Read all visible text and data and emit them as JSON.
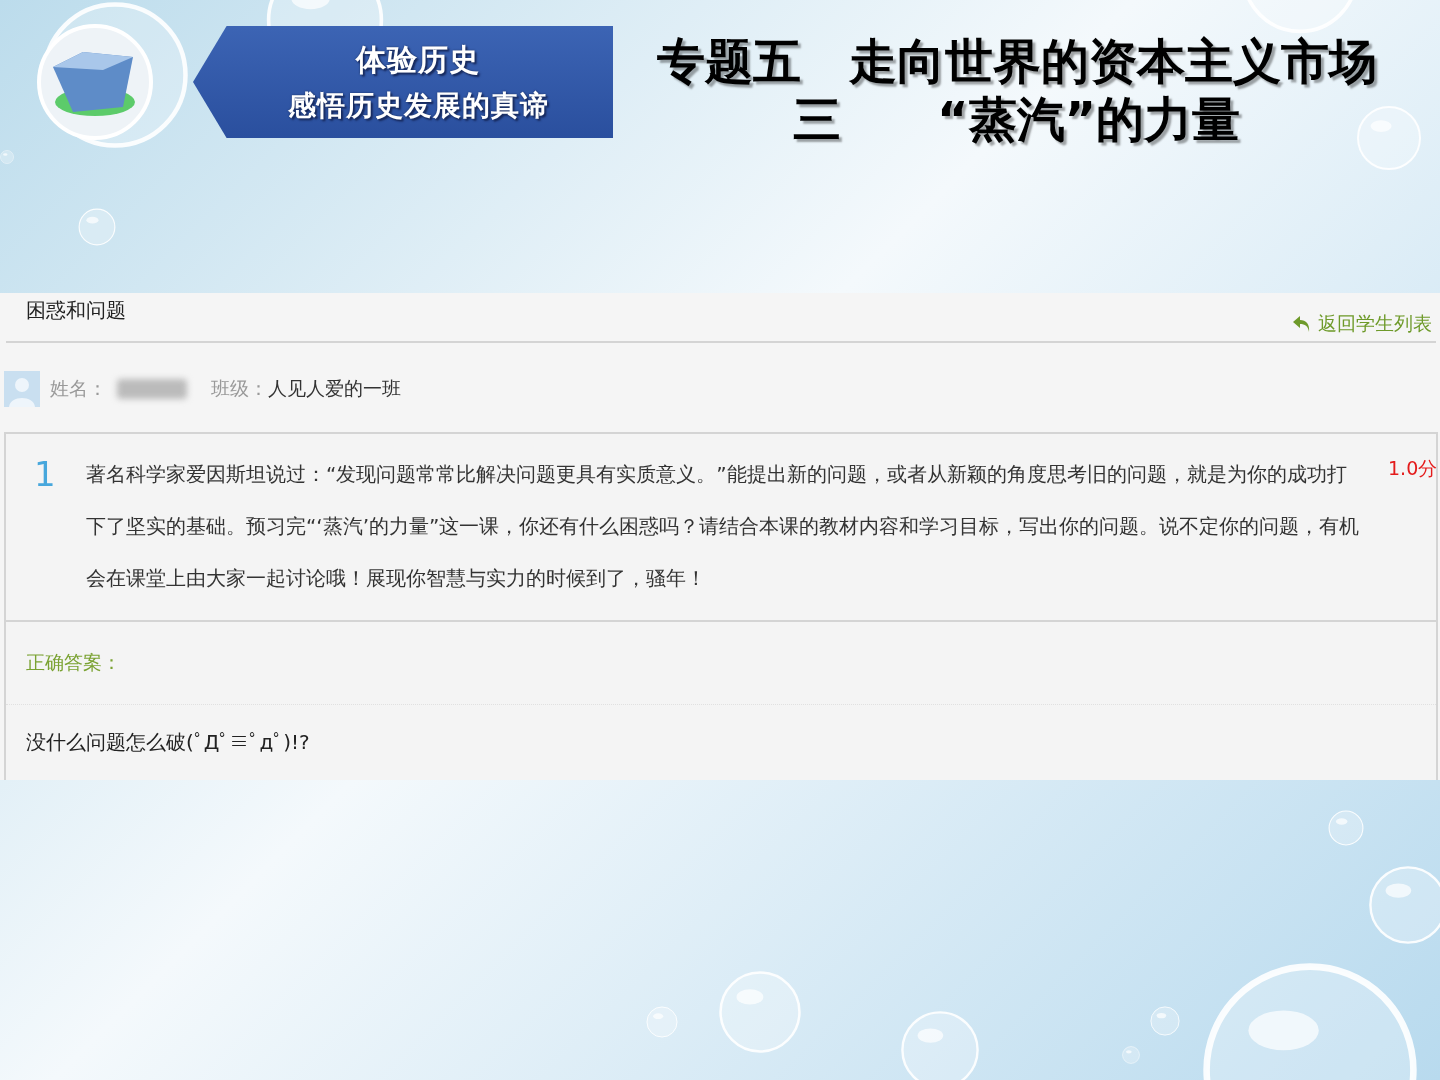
{
  "slide": {
    "banner": {
      "lines": [
        "体验历史",
        "感悟历史发展的真谛"
      ]
    },
    "title_lines": [
      "专题五　走向世界的资本主义市场",
      "三　　“蒸汽”的力量"
    ]
  },
  "page": {
    "title": "困惑和问题",
    "back_link": "返回学生列表",
    "student": {
      "name_label": "姓名：",
      "class_label": "班级：",
      "class_value": "人见人爱的一班"
    },
    "question": {
      "number": "1",
      "text": "著名科学家爱因斯坦说过：“发现问题常常比解决问题更具有实质意义。”能提出新的问题，或者从新颖的角度思考旧的问题，就是为你的成功打下了坚实的基础。预习完“‘蒸汽’的力量”这一课，你还有什么困惑吗？请结合本课的教材内容和学习目标，写出你的问题。说不定你的问题，有机会在课堂上由大家一起讨论哦！展现你智慧与实力的时候到了，骚年！",
      "score": "1.0分"
    },
    "answer": {
      "label": "正确答案：",
      "text": "没什么问题怎么破(ﾟДﾟ≡ﾟдﾟ)!?"
    }
  }
}
